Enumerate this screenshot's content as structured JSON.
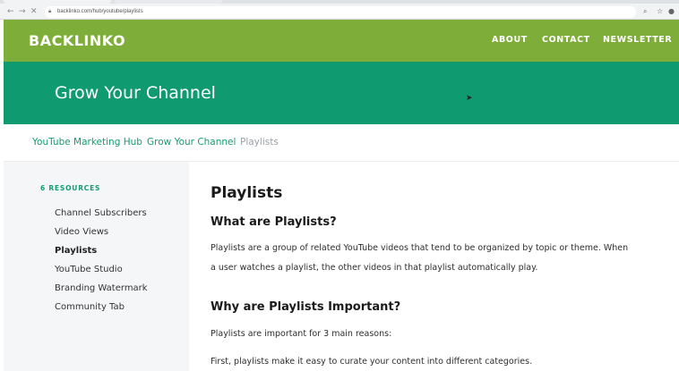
{
  "browser": {
    "url": "backlinko.com/hub/youtube/playlists",
    "nav": {
      "back": "←",
      "forward": "→",
      "stop": "✕"
    },
    "icons": {
      "lock": "lock-icon",
      "zoom": "zoom-icon",
      "star": "star-icon",
      "account": "account-icon"
    }
  },
  "site": {
    "logo": "BACKLINKO",
    "nav": {
      "about": "ABOUT",
      "contact": "CONTACT",
      "newsletter": "NEWSLETTER"
    },
    "colors": {
      "header": "#7fad39",
      "hero": "#0f9a6f",
      "accent": "#169b6e",
      "sidebar_bg": "#f5f6f8"
    }
  },
  "hero": {
    "title": "Grow Your Channel"
  },
  "breadcrumb": {
    "items": [
      "YouTube Marketing Hub",
      "Grow Your Channel",
      "Playlists"
    ]
  },
  "sidebar": {
    "heading": "6 RESOURCES",
    "items": [
      {
        "label": "Channel Subscribers"
      },
      {
        "label": "Video Views"
      },
      {
        "label": "Playlists"
      },
      {
        "label": "YouTube Studio"
      },
      {
        "label": "Branding Watermark"
      },
      {
        "label": "Community Tab"
      }
    ]
  },
  "article": {
    "title": "Playlists",
    "section1": {
      "heading": "What are Playlists?",
      "line1": "Playlists are a group of related YouTube videos that tend to be organized by topic or theme. When",
      "line2": "a user watches a playlist, the other videos in that playlist automatically play."
    },
    "section2": {
      "heading": "Why are Playlists Important?",
      "line1": "Playlists are important for 3 main reasons:",
      "line2": "First, playlists make it easy to curate your content into different categories."
    }
  }
}
